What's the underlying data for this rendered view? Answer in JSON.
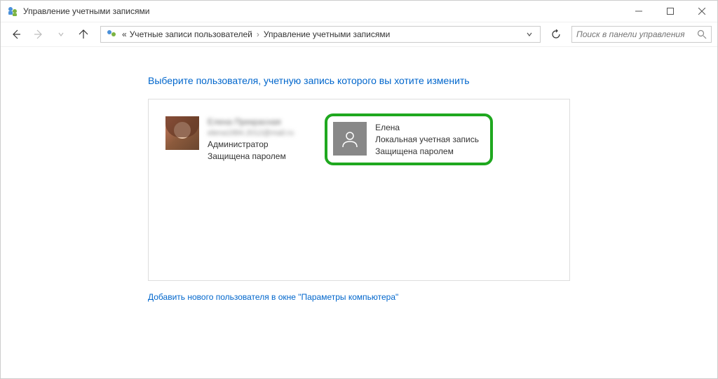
{
  "window": {
    "title": "Управление учетными записями"
  },
  "breadcrumb": {
    "prefix": "«",
    "items": [
      "Учетные записи пользователей",
      "Управление учетными записями"
    ]
  },
  "search": {
    "placeholder": "Поиск в панели управления"
  },
  "content": {
    "heading": "Выберите пользователя, учетную запись которого вы хотите изменить",
    "add_user_link": "Добавить нового пользователя в окне \"Параметры компьютера\""
  },
  "accounts": [
    {
      "name": "Елена Прекрасная",
      "email": "elena1984.2012@mail.ru",
      "role": "Администратор",
      "protection": "Защищена паролем",
      "blurred": true,
      "avatar_type": "photo"
    },
    {
      "name": "Елена",
      "account_type": "Локальная учетная запись",
      "protection": "Защищена паролем",
      "highlighted": true,
      "avatar_type": "placeholder"
    }
  ]
}
